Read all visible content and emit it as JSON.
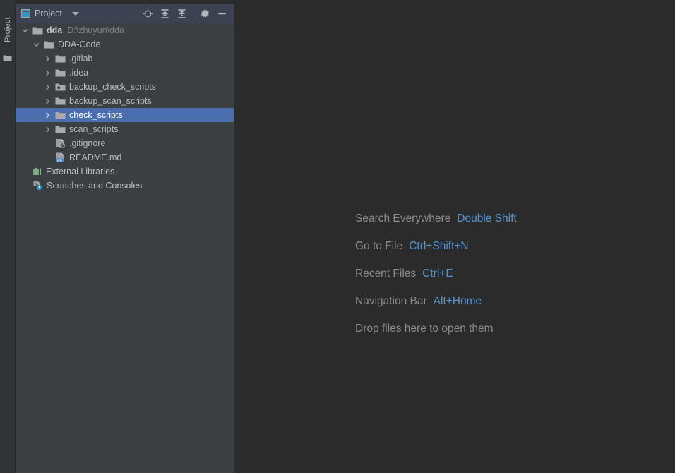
{
  "window": {
    "background_editor": "#2b2b2b",
    "background_panel": "#3c3f41",
    "background_toolbar": "#3c4251",
    "accent_selection": "#4b6eaf",
    "accent_link": "#5294d6"
  },
  "tool_strip": {
    "tab_label": "Project",
    "tab_name": "project-tool-window-tab",
    "bottom_icon": "folder-icon"
  },
  "panel_toolbar": {
    "tab_label": "Project",
    "tab_icon": "project-view-icon",
    "dropdown_icon": "chevron-down-icon",
    "actions": [
      {
        "name": "select-opened-file-icon",
        "title": "Select Opened File"
      },
      {
        "name": "expand-all-icon",
        "title": "Expand All"
      },
      {
        "name": "collapse-all-icon",
        "title": "Collapse All"
      },
      {
        "name": "settings-gear-icon",
        "title": "Settings"
      },
      {
        "name": "hide-minimize-icon",
        "title": "Hide"
      }
    ]
  },
  "project_tree": {
    "nodes": [
      {
        "label": "dda",
        "path": "D:\\zhuyun\\dda",
        "icon": "folder-icon",
        "twisty": "expanded",
        "indent": 0,
        "bold": true,
        "selected": false,
        "name": "tree-node-dda"
      },
      {
        "label": "DDA-Code",
        "path": "",
        "icon": "folder-icon",
        "twisty": "expanded",
        "indent": 1,
        "bold": false,
        "selected": false,
        "name": "tree-node-dda-code"
      },
      {
        "label": ".gitlab",
        "path": "",
        "icon": "folder-icon",
        "twisty": "collapsed",
        "indent": 2,
        "bold": false,
        "selected": false,
        "name": "tree-node-gitlab"
      },
      {
        "label": ".idea",
        "path": "",
        "icon": "folder-icon",
        "twisty": "collapsed",
        "indent": 2,
        "bold": false,
        "selected": false,
        "name": "tree-node-idea"
      },
      {
        "label": "backup_check_scripts",
        "path": "",
        "icon": "folder-module-icon",
        "twisty": "collapsed",
        "indent": 2,
        "bold": false,
        "selected": false,
        "name": "tree-node-backup-check-scripts"
      },
      {
        "label": "backup_scan_scripts",
        "path": "",
        "icon": "folder-icon",
        "twisty": "collapsed",
        "indent": 2,
        "bold": false,
        "selected": false,
        "name": "tree-node-backup-scan-scripts"
      },
      {
        "label": "check_scripts",
        "path": "",
        "icon": "folder-icon",
        "twisty": "collapsed",
        "indent": 2,
        "bold": false,
        "selected": true,
        "name": "tree-node-check-scripts"
      },
      {
        "label": "scan_scripts",
        "path": "",
        "icon": "folder-icon",
        "twisty": "collapsed",
        "indent": 2,
        "bold": false,
        "selected": false,
        "name": "tree-node-scan-scripts"
      },
      {
        "label": ".gitignore",
        "path": "",
        "icon": "gitignore-file-icon",
        "twisty": "none",
        "indent": 2,
        "bold": false,
        "selected": false,
        "name": "tree-node-gitignore"
      },
      {
        "label": "README.md",
        "path": "",
        "icon": "markdown-file-icon",
        "twisty": "none",
        "indent": 2,
        "bold": false,
        "selected": false,
        "name": "tree-node-readme"
      },
      {
        "label": "External Libraries",
        "path": "",
        "icon": "external-libraries-icon",
        "twisty": "none",
        "indent": 0,
        "bold": false,
        "selected": false,
        "name": "tree-node-external-libraries"
      },
      {
        "label": "Scratches and Consoles",
        "path": "",
        "icon": "scratches-icon",
        "twisty": "none",
        "indent": 0,
        "bold": false,
        "selected": false,
        "name": "tree-node-scratches-and-consoles"
      }
    ]
  },
  "editor_hints": [
    {
      "label": "Search Everywhere",
      "key": "Double Shift",
      "name": "hint-search-everywhere"
    },
    {
      "label": "Go to File",
      "key": "Ctrl+Shift+N",
      "name": "hint-go-to-file"
    },
    {
      "label": "Recent Files",
      "key": "Ctrl+E",
      "name": "hint-recent-files"
    },
    {
      "label": "Navigation Bar",
      "key": "Alt+Home",
      "name": "hint-navigation-bar"
    },
    {
      "label": "Drop files here to open them",
      "key": "",
      "name": "hint-drop-files"
    }
  ]
}
